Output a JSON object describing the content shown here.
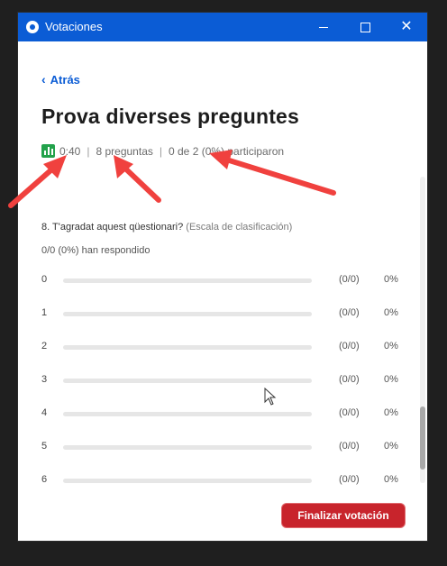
{
  "window": {
    "title": "Votaciones",
    "minimize_label": "—",
    "close_label": "✕"
  },
  "nav": {
    "back_label": "Atrás",
    "back_icon": "chevron-left-icon"
  },
  "poll": {
    "title": "Prova diverses preguntes",
    "duration": "0:40",
    "questions": "8 preguntas",
    "participation": "0 de 2 (0%) participaron"
  },
  "question": {
    "text": "8. T'agradat aquest qüestionari?",
    "type": "(Escala de clasificación)",
    "responded": "0/0 (0%) han respondido",
    "options": [
      {
        "label": "0",
        "count": "(0/0)",
        "pct": "0%",
        "fill": 0
      },
      {
        "label": "1",
        "count": "(0/0)",
        "pct": "0%",
        "fill": 0
      },
      {
        "label": "2",
        "count": "(0/0)",
        "pct": "0%",
        "fill": 0
      },
      {
        "label": "3",
        "count": "(0/0)",
        "pct": "0%",
        "fill": 0
      },
      {
        "label": "4",
        "count": "(0/0)",
        "pct": "0%",
        "fill": 0
      },
      {
        "label": "5",
        "count": "(0/0)",
        "pct": "0%",
        "fill": 0
      },
      {
        "label": "6",
        "count": "(0/0)",
        "pct": "0%",
        "fill": 0
      }
    ]
  },
  "actions": {
    "end_poll_label": "Finalizar votación"
  },
  "colors": {
    "titlebar": "#0b5cd5",
    "link": "#0b5cd5",
    "end_button": "#c8242c",
    "chart_icon": "#22a24b",
    "arrow": "#f0413e"
  }
}
